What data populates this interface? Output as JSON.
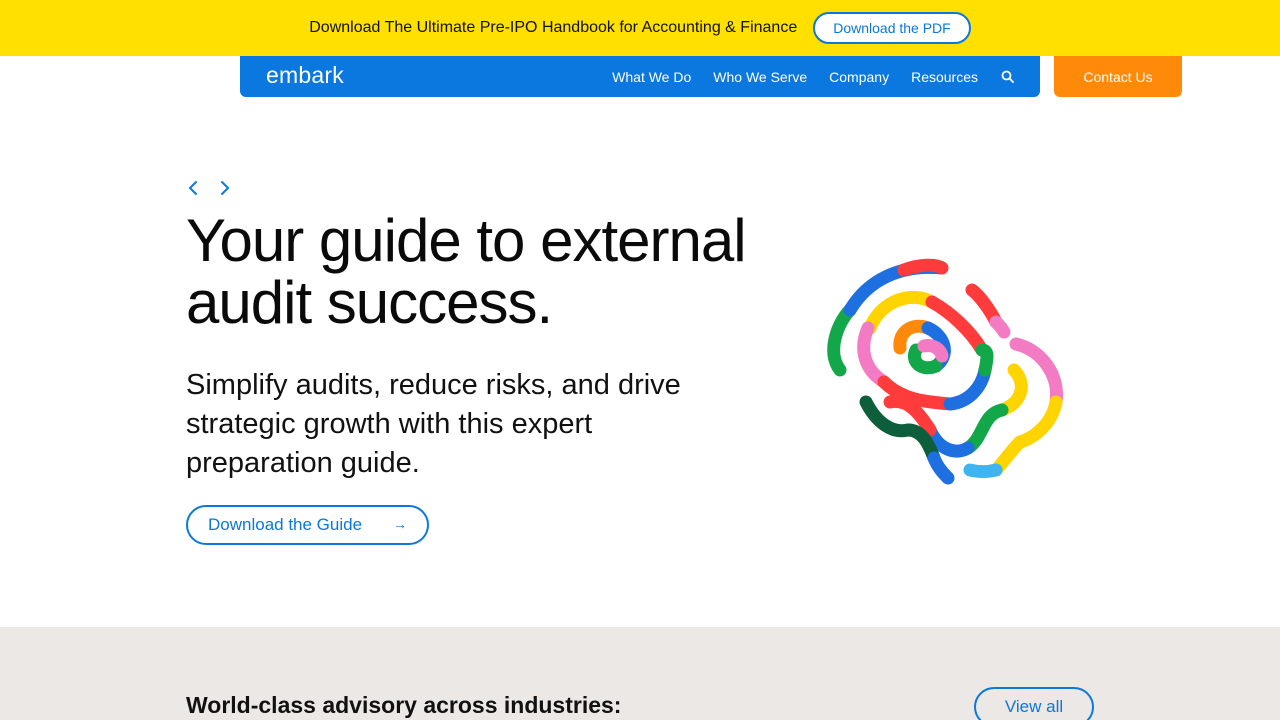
{
  "promo": {
    "text": "Download The Ultimate Pre-IPO Handbook for Accounting & Finance",
    "button_label": "Download the PDF"
  },
  "nav": {
    "logo": "embark",
    "links": [
      "What We Do",
      "Who We Serve",
      "Company",
      "Resources"
    ],
    "search_icon": "search-icon",
    "contact_label": "Contact Us"
  },
  "hero": {
    "title_line1": "Your guide to external",
    "title_line2": "audit success.",
    "subtitle": "Simplify audits, reduce risks, and drive strategic growth with this expert preparation guide.",
    "button_label": "Download the Guide",
    "button_arrow": "→",
    "prev_icon": "chevron-left-icon",
    "next_icon": "chevron-right-icon"
  },
  "industries": {
    "title": "World-class advisory across industries:",
    "view_all_label": "View all"
  },
  "colors": {
    "promo_bg": "#ffe000",
    "brand_blue": "#0b78df",
    "accent_orange": "#ff8a0a",
    "section_bg": "#ece8e5"
  }
}
